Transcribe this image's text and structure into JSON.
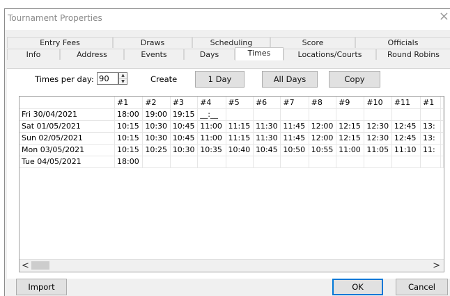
{
  "window": {
    "title": "Tournament Properties",
    "close_glyph": "×"
  },
  "tabs_row1": [
    "Entry Fees",
    "Draws",
    "Scheduling",
    "Score",
    "Officials"
  ],
  "tabs_row2": [
    "Info",
    "Address",
    "Events",
    "Days",
    "Times",
    "Locations/Courts",
    "Round Robins"
  ],
  "active_tab": "Times",
  "controls": {
    "times_per_day_label": "Times per day:",
    "times_per_day_value": "90",
    "create_label": "Create",
    "btn_1day": "1 Day",
    "btn_alldays": "All Days",
    "btn_copy": "Copy"
  },
  "grid": {
    "columns": [
      "#1",
      "#2",
      "#3",
      "#4",
      "#5",
      "#6",
      "#7",
      "#8",
      "#9",
      "#10",
      "#11",
      "#1"
    ],
    "rows": [
      {
        "date": "Fri 30/04/2021",
        "times": [
          "18:00",
          "19:00",
          "19:15",
          "__:__",
          "",
          "",
          "",
          "",
          "",
          "",
          "",
          ""
        ]
      },
      {
        "date": "Sat 01/05/2021",
        "times": [
          "10:15",
          "10:30",
          "10:45",
          "11:00",
          "11:15",
          "11:30",
          "11:45",
          "12:00",
          "12:15",
          "12:30",
          "12:45",
          "13:"
        ]
      },
      {
        "date": "Sun 02/05/2021",
        "times": [
          "10:15",
          "10:30",
          "10:45",
          "11:00",
          "11:15",
          "11:30",
          "11:45",
          "12:00",
          "12:15",
          "12:30",
          "12:45",
          "13:"
        ]
      },
      {
        "date": "Mon 03/05/2021",
        "times": [
          "10:15",
          "10:25",
          "10:30",
          "10:35",
          "10:40",
          "10:45",
          "10:50",
          "10:55",
          "11:00",
          "11:05",
          "11:10",
          "11:"
        ]
      },
      {
        "date": "Tue 04/05/2021",
        "times": [
          "18:00",
          "",
          "",
          "",
          "",
          "",
          "",
          "",
          "",
          "",
          "",
          ""
        ]
      }
    ],
    "scroll_left": "<",
    "scroll_right": ">"
  },
  "footer": {
    "import": "Import",
    "ok": "OK",
    "cancel": "Cancel"
  }
}
